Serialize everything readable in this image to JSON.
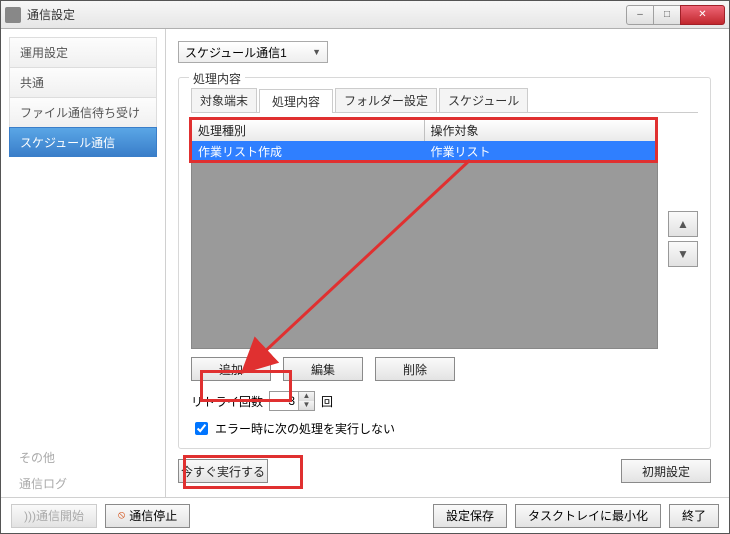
{
  "window": {
    "title": "通信設定"
  },
  "winbuttons": {
    "min": "–",
    "max": "□",
    "close": "✕"
  },
  "sidebar": {
    "items": [
      {
        "label": "運用設定"
      },
      {
        "label": "共通"
      },
      {
        "label": "ファイル通信待ち受け"
      },
      {
        "label": "スケジュール通信"
      }
    ],
    "bottom": [
      {
        "label": "その他"
      },
      {
        "label": "通信ログ"
      }
    ]
  },
  "schedule_select": {
    "value": "スケジュール通信1"
  },
  "group": {
    "title": "処理内容"
  },
  "tabs": [
    {
      "label": "対象端末"
    },
    {
      "label": "処理内容"
    },
    {
      "label": "フォルダー設定"
    },
    {
      "label": "スケジュール"
    }
  ],
  "table": {
    "headers": [
      "処理種別",
      "操作対象"
    ],
    "rows": [
      {
        "col0": "作業リスト作成",
        "col1": "作業リスト"
      }
    ]
  },
  "buttons": {
    "add": "追加",
    "edit": "編集",
    "delete": "削除"
  },
  "retry": {
    "label": "リトライ回数",
    "value": "3",
    "unit": "回"
  },
  "checkbox": {
    "label": "エラー時に次の処理を実行しない",
    "checked": true
  },
  "exec": {
    "now": "今すぐ実行する",
    "reset": "初期設定"
  },
  "footer": {
    "start": "通信開始",
    "stop": "通信停止",
    "save": "設定保存",
    "tray": "タスクトレイに最小化",
    "close": "終了"
  }
}
